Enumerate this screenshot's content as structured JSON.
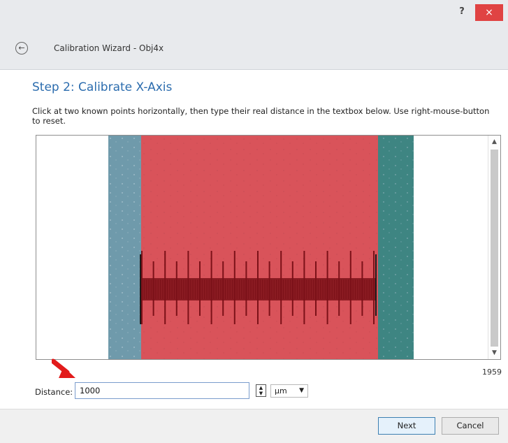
{
  "window": {
    "help_label": "?",
    "close_label": "×"
  },
  "header": {
    "back_icon": "arrow-left-icon",
    "title": "Calibration Wizard - Obj4x"
  },
  "step": {
    "title": "Step 2: Calibrate X-Axis",
    "instruction": "Click at two known points horizontally, then type their real distance in the textbox below. Use right-mouse-button to reset."
  },
  "viewer": {
    "image_content": "microscope-ruler-image",
    "pixel_distance": "1959"
  },
  "distance": {
    "label": "Distance:",
    "value": "1000",
    "unit": "µm"
  },
  "footer": {
    "next_label": "Next",
    "cancel_label": "Cancel"
  },
  "colors": {
    "accent": "#2b6cae",
    "close": "#e04343",
    "highlight_overlay": "#d9535a",
    "pointer_arrow": "#e21b1b"
  }
}
